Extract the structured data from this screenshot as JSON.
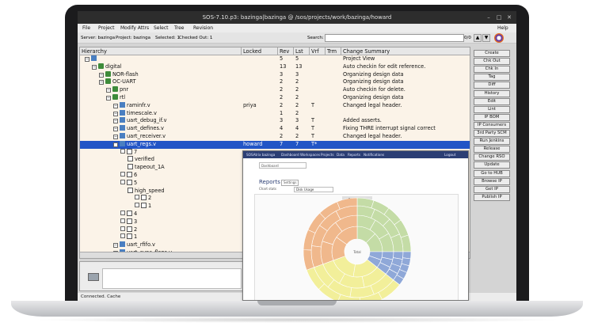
{
  "window": {
    "title": "SOS-7.10.p3: bazinga|bazinga @ /sos/projects/work/bazinga/howard"
  },
  "menu": {
    "file": "File",
    "project": "Project",
    "modify_attrs": "Modify Attrs",
    "select": "Select",
    "tree": "Tree",
    "revision": "Revision",
    "help": "Help"
  },
  "info": {
    "server": "Server: bazinga",
    "project": "Project: bazinga",
    "selected": "Selected: 1",
    "checked_out": "Checked Out: 1",
    "search_label": "Search:",
    "search_value": "",
    "match_count": "0/0"
  },
  "columns": [
    "Hierarchy",
    "Locked",
    "Rev",
    "Lst",
    "Vrf",
    "Trm",
    "Change Summary"
  ],
  "rows": [
    {
      "name": "",
      "locked": "",
      "rev": "5",
      "lst": "5",
      "vrf": "",
      "trm": "",
      "summary": "Project View"
    },
    {
      "name": "digital",
      "locked": "",
      "rev": "13",
      "lst": "13",
      "vrf": "",
      "trm": "",
      "summary": "Auto checkin for edit reference."
    },
    {
      "name": "NOR-flash",
      "locked": "",
      "rev": "3",
      "lst": "3",
      "vrf": "",
      "trm": "",
      "summary": "Organizing design data"
    },
    {
      "name": "OC-UART",
      "locked": "",
      "rev": "2",
      "lst": "2",
      "vrf": "",
      "trm": "",
      "summary": "Organizing design data"
    },
    {
      "name": "pnr",
      "locked": "",
      "rev": "2",
      "lst": "2",
      "vrf": "",
      "trm": "",
      "summary": "Auto checkin for delete."
    },
    {
      "name": "rtl",
      "locked": "",
      "rev": "2",
      "lst": "2",
      "vrf": "",
      "trm": "",
      "summary": "Organizing design data"
    },
    {
      "name": "raminfr.v",
      "locked": "priya",
      "rev": "2",
      "lst": "2",
      "vrf": "T",
      "trm": "",
      "summary": "Changed legal header."
    },
    {
      "name": "timescale.v",
      "locked": "",
      "rev": "1",
      "lst": "2",
      "vrf": "",
      "trm": "",
      "summary": ""
    },
    {
      "name": "uart_debug_if.v",
      "locked": "",
      "rev": "3",
      "lst": "3",
      "vrf": "T",
      "trm": "",
      "summary": "Added asserts."
    },
    {
      "name": "uart_defines.v",
      "locked": "",
      "rev": "4",
      "lst": "4",
      "vrf": "T",
      "trm": "",
      "summary": "Fixing THRE interrupt signal correct"
    },
    {
      "name": "uart_receiver.v",
      "locked": "",
      "rev": "2",
      "lst": "2",
      "vrf": "T",
      "trm": "",
      "summary": "Changed legal header."
    },
    {
      "name": "uart_regs.v",
      "locked": "howard",
      "rev": "7",
      "lst": "7",
      "vrf": "T*",
      "trm": "",
      "summary": ""
    },
    {
      "name": "7",
      "locked": "",
      "rev": "",
      "lst": "",
      "vrf": "",
      "trm": "",
      "summary": ""
    },
    {
      "name": "verified",
      "locked": "",
      "rev": "",
      "lst": "",
      "vrf": "",
      "trm": "",
      "summary": ""
    },
    {
      "name": "tapeout_1A",
      "locked": "",
      "rev": "",
      "lst": "",
      "vrf": "",
      "trm": "",
      "summary": ""
    },
    {
      "name": "6",
      "locked": "",
      "rev": "",
      "lst": "",
      "vrf": "",
      "trm": "",
      "summary": ""
    },
    {
      "name": "5",
      "locked": "",
      "rev": "",
      "lst": "",
      "vrf": "",
      "trm": "",
      "summary": ""
    },
    {
      "name": "high_speed",
      "locked": "",
      "rev": "",
      "lst": "",
      "vrf": "",
      "trm": "",
      "summary": ""
    },
    {
      "name": "2",
      "locked": "",
      "rev": "",
      "lst": "",
      "vrf": "",
      "trm": "",
      "summary": ""
    },
    {
      "name": "1",
      "locked": "",
      "rev": "",
      "lst": "",
      "vrf": "",
      "trm": "",
      "summary": ""
    },
    {
      "name": "4",
      "locked": "",
      "rev": "",
      "lst": "",
      "vrf": "",
      "trm": "",
      "summary": ""
    },
    {
      "name": "3",
      "locked": "",
      "rev": "",
      "lst": "",
      "vrf": "",
      "trm": "",
      "summary": ""
    },
    {
      "name": "2",
      "locked": "",
      "rev": "",
      "lst": "",
      "vrf": "",
      "trm": "",
      "summary": ""
    },
    {
      "name": "1",
      "locked": "",
      "rev": "",
      "lst": "",
      "vrf": "",
      "trm": "",
      "summary": ""
    },
    {
      "name": "uart_rfifo.v",
      "locked": "",
      "rev": "",
      "lst": "",
      "vrf": "",
      "trm": "",
      "summary": ""
    },
    {
      "name": "uart_sync_flops.v",
      "locked": "",
      "rev": "",
      "lst": "",
      "vrf": "",
      "trm": "",
      "summary": ""
    }
  ],
  "selected_row": 11,
  "side_buttons": [
    "Create",
    "Chk Out",
    "Chk In",
    "Tag",
    "Diff",
    "History",
    "Edit",
    "Lint",
    "IP BOM",
    "IP Consumers",
    "3rd Party SCM",
    "Run Jenkins",
    "Release",
    "Change RSO",
    "Update",
    "Go to HUB",
    "Browse IP",
    "Get IP",
    "Publish IP"
  ],
  "status": "Connected. Cache",
  "overlay": {
    "brand": "SOSAtrix bazinga",
    "nav": [
      "Dashboard",
      "Workspaces",
      "Projects",
      "Data",
      "Reports",
      "Notifications"
    ],
    "user": "Logout",
    "breadcrumb": "Dashboard",
    "title": "Reports",
    "tag_button": "Settings",
    "chart_label": "Chart stats",
    "chart_select": "Disk Usage",
    "chart_title": "Disk Usage",
    "center_label": "Total"
  },
  "colors": {
    "selection": "#2255c6",
    "grid_bg": "#fbf3e8",
    "overlay_nav": "#2b3e74"
  }
}
